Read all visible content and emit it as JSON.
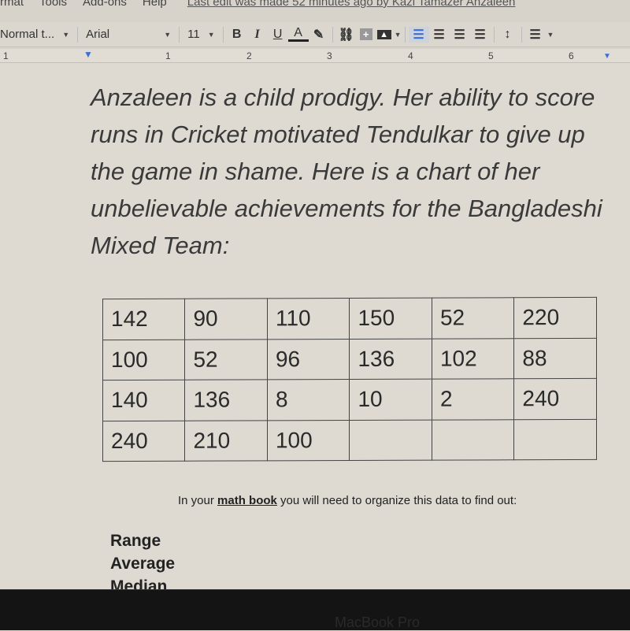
{
  "menu": {
    "items": [
      "rmat",
      "Tools",
      "Add-ons",
      "Help"
    ],
    "last_edit": "Last edit was made 52 minutes ago by Kazi Tamazer Anzaleen"
  },
  "toolbar": {
    "style": "Normal t...",
    "font": "Arial",
    "size": "11",
    "bold": "B",
    "italic": "I",
    "underline": "U",
    "text_color": "A"
  },
  "ruler": {
    "marks": [
      "1",
      "1",
      "2",
      "3",
      "4",
      "5",
      "6"
    ]
  },
  "document": {
    "paragraph": "Anzaleen is a child prodigy.  Her ability to score runs in Cricket motivated Tendulkar to give up the game in shame.  Here is a chart of her unbelievable achievements for the Bangladeshi Mixed Team:",
    "table": [
      [
        "142",
        "90",
        "110",
        "150",
        "52",
        "220"
      ],
      [
        "100",
        "52",
        "96",
        "136",
        "102",
        "88"
      ],
      [
        "140",
        "136",
        "8",
        "10",
        "2",
        "240"
      ],
      " "
    ],
    "table_last_row": [
      "240",
      "210",
      "100",
      "",
      "",
      ""
    ],
    "note_prefix": "In your ",
    "note_bold": "math book",
    "note_suffix": " you will need to organize this data to find out:",
    "terms": [
      "Range",
      "Average",
      "Median"
    ]
  },
  "device": {
    "brand": "MacBook Pro"
  }
}
